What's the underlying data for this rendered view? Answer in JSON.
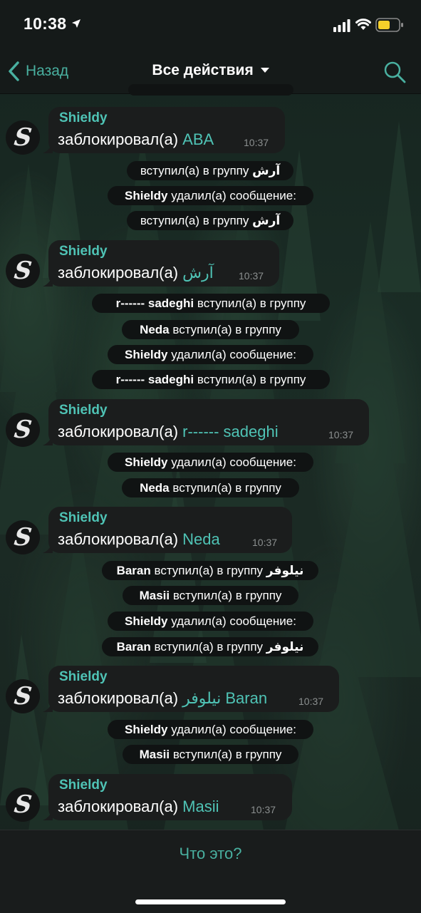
{
  "status": {
    "time": "10:38"
  },
  "nav": {
    "back_label": "Назад",
    "title": "Все действия"
  },
  "top_partial": "",
  "messages": [
    {
      "sender": "Shieldy",
      "text": "заблокировал(а) ",
      "highlight": "ABA",
      "time": "10:37"
    },
    {
      "sender": "Shieldy",
      "text": "заблокировал(а) ",
      "highlight": "آرش",
      "time": "10:37"
    },
    {
      "sender": "Shieldy",
      "text": "заблокировал(а) ",
      "highlight": "r------ sadeghi",
      "time": "10:37"
    },
    {
      "sender": "Shieldy",
      "text": "заблокировал(а) ",
      "highlight": "Neda",
      "time": "10:37"
    },
    {
      "sender": "Shieldy",
      "text": "заблокировал(а) ",
      "highlight": "نیلوفر Baran",
      "time": "10:37"
    },
    {
      "sender": "Shieldy",
      "text": "заблокировал(а) ",
      "highlight": "Masii",
      "time": "10:37"
    }
  ],
  "service": [
    {
      "pre": "",
      "bold": "",
      "post": "вступил(а) в группу ",
      "bold2": "آرش"
    },
    {
      "pre": "",
      "bold": "Shieldy",
      "post": " удалил(а) сообщение:",
      "bold2": ""
    },
    {
      "pre": "",
      "bold": "",
      "post": "вступил(а) в группу ",
      "bold2": "آرش"
    },
    {
      "pre": "",
      "bold": "r------ sadeghi",
      "post": " вступил(а) в группу",
      "bold2": ""
    },
    {
      "pre": "",
      "bold": "Neda",
      "post": " вступил(а) в группу",
      "bold2": ""
    },
    {
      "pre": "",
      "bold": "Shieldy",
      "post": " удалил(а) сообщение:",
      "bold2": ""
    },
    {
      "pre": "",
      "bold": "r------ sadeghi",
      "post": " вступил(а) в группу",
      "bold2": ""
    },
    {
      "pre": "",
      "bold": "Shieldy",
      "post": " удалил(а) сообщение:",
      "bold2": ""
    },
    {
      "pre": "",
      "bold": "Neda",
      "post": " вступил(а) в группу",
      "bold2": ""
    },
    {
      "pre": "",
      "bold": "Baran",
      "post": " вступил(а) в группу ",
      "bold2": "نیلوفر"
    },
    {
      "pre": "",
      "bold": "Masii",
      "post": " вступил(а) в группу",
      "bold2": ""
    },
    {
      "pre": "",
      "bold": "Shieldy",
      "post": " удалил(а) сообщение:",
      "bold2": ""
    },
    {
      "pre": "",
      "bold": "Baran",
      "post": " вступил(а) в группу ",
      "bold2": "نیلوفر"
    },
    {
      "pre": "",
      "bold": "Shieldy",
      "post": " удалил(а) сообщение:",
      "bold2": ""
    },
    {
      "pre": "",
      "bold": "Masii",
      "post": " вступил(а) в группу",
      "bold2": ""
    }
  ],
  "bottom": {
    "button_label": "Что это?"
  },
  "colors": {
    "accent": "#49b0a0",
    "highlight": "#4fc3b5",
    "bubble": "#1b1d1d"
  },
  "icons": {
    "back": "chevron-left-icon",
    "search": "search-icon",
    "caret": "caret-down-icon"
  }
}
